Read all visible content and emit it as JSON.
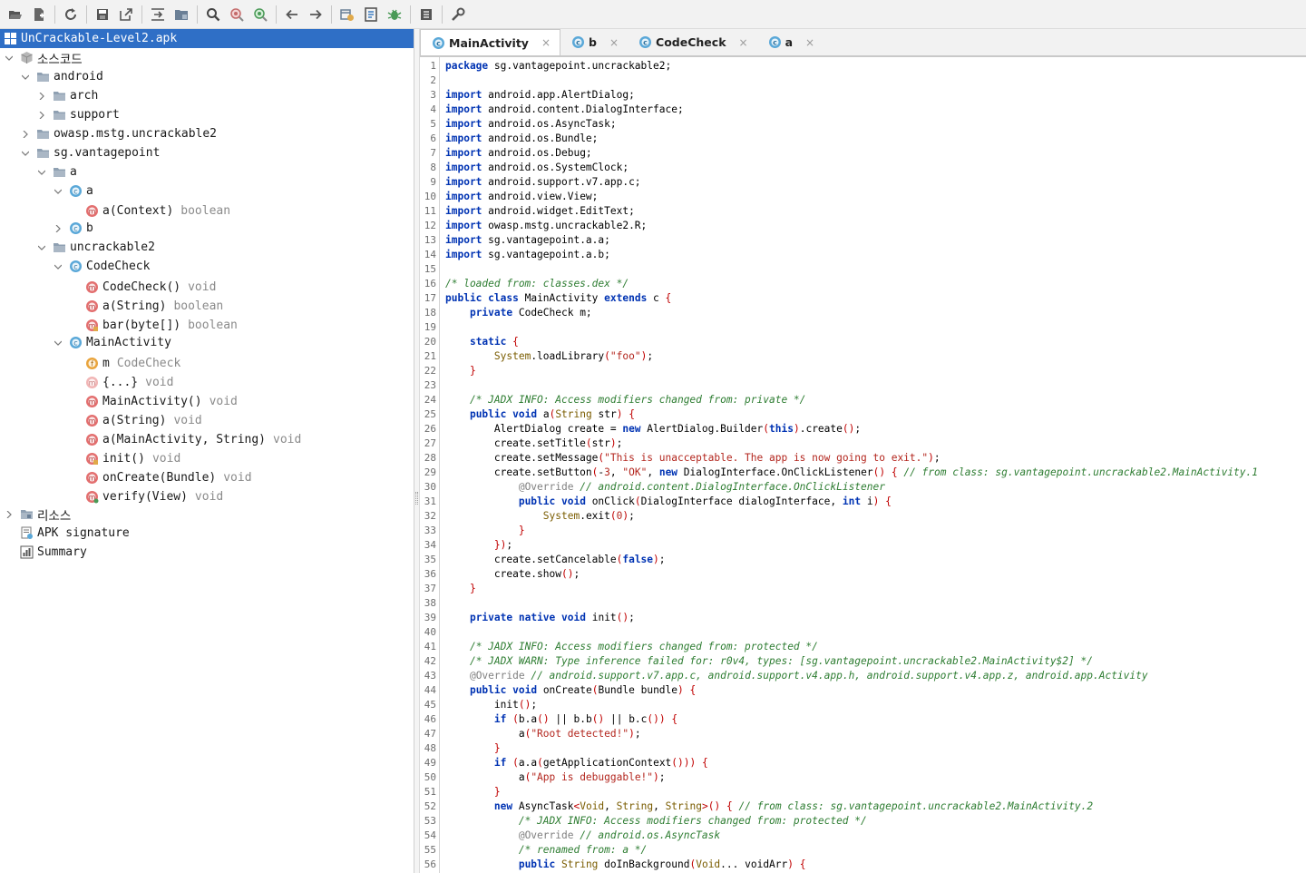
{
  "toolbar": {
    "icons": [
      "open-file-icon",
      "add-file-icon",
      "refresh-icon",
      "save-icon",
      "export-icon",
      "sync-tree-icon",
      "flatten-packages-icon",
      "search-icon",
      "search-class-icon",
      "search-usage-icon",
      "back-icon",
      "forward-icon",
      "deobfuscation-icon",
      "log-viewer-icon",
      "debug-icon",
      "text-icon",
      "preferences-icon"
    ]
  },
  "tree": {
    "root": "UnCrackable-Level2.apk",
    "sources": "소스코드",
    "pkg_android": "android",
    "pkg_arch": "arch",
    "pkg_support": "support",
    "pkg_owasp": "owasp.mstg.uncrackable2",
    "pkg_sg": "sg.vantagepoint",
    "pkg_a": "a",
    "cls_a": "a",
    "m_a_context": "a(Context)",
    "m_a_context_type": "boolean",
    "cls_b": "b",
    "pkg_uncrackable2": "uncrackable2",
    "cls_codecheck": "CodeCheck",
    "m_codecheck_ctor": "CodeCheck()",
    "m_codecheck_ctor_type": "void",
    "m_a_string": "a(String)",
    "m_a_string_type": "boolean",
    "m_bar": "bar(byte[])",
    "m_bar_type": "boolean",
    "cls_mainactivity": "MainActivity",
    "f_m": "m",
    "f_m_type": "CodeCheck",
    "m_static": "{...}",
    "m_static_type": "void",
    "m_main_ctor": "MainActivity()",
    "m_main_ctor_type": "void",
    "m_main_a_string": "a(String)",
    "m_main_a_string_type": "void",
    "m_main_a_two": "a(MainActivity, String)",
    "m_main_a_two_type": "void",
    "m_init": "init()",
    "m_init_type": "void",
    "m_oncreate": "onCreate(Bundle)",
    "m_oncreate_type": "void",
    "m_verify": "verify(View)",
    "m_verify_type": "void",
    "resources": "리소스",
    "apk_signature": "APK signature",
    "summary": "Summary"
  },
  "tabs": [
    {
      "label": "MainActivity",
      "close": "×"
    },
    {
      "label": "b",
      "close": "×"
    },
    {
      "label": "CodeCheck",
      "close": "×"
    },
    {
      "label": "a",
      "close": "×"
    }
  ],
  "code": [
    "package sg.vantagepoint.uncrackable2;",
    "",
    "import android.app.AlertDialog;",
    "import android.content.DialogInterface;",
    "import android.os.AsyncTask;",
    "import android.os.Bundle;",
    "import android.os.Debug;",
    "import android.os.SystemClock;",
    "import android.support.v7.app.c;",
    "import android.view.View;",
    "import android.widget.EditText;",
    "import owasp.mstg.uncrackable2.R;",
    "import sg.vantagepoint.a.a;",
    "import sg.vantagepoint.a.b;",
    "",
    "/* loaded from: classes.dex */",
    "public class MainActivity extends c {",
    "    private CodeCheck m;",
    "",
    "    static {",
    "        System.loadLibrary(\"foo\");",
    "    }",
    "",
    "    /* JADX INFO: Access modifiers changed from: private */",
    "    public void a(String str) {",
    "        AlertDialog create = new AlertDialog.Builder(this).create();",
    "        create.setTitle(str);",
    "        create.setMessage(\"This is unacceptable. The app is now going to exit.\");",
    "        create.setButton(-3, \"OK\", new DialogInterface.OnClickListener() { // from class: sg.vantagepoint.uncrackable2.MainActivity.1",
    "            @Override // android.content.DialogInterface.OnClickListener",
    "            public void onClick(DialogInterface dialogInterface, int i) {",
    "                System.exit(0);",
    "            }",
    "        });",
    "        create.setCancelable(false);",
    "        create.show();",
    "    }",
    "",
    "    private native void init();",
    "",
    "    /* JADX INFO: Access modifiers changed from: protected */",
    "    /* JADX WARN: Type inference failed for: r0v4, types: [sg.vantagepoint.uncrackable2.MainActivity$2] */",
    "    @Override // android.support.v7.app.c, android.support.v4.app.h, android.support.v4.app.z, android.app.Activity",
    "    public void onCreate(Bundle bundle) {",
    "        init();",
    "        if (b.a() || b.b() || b.c()) {",
    "            a(\"Root detected!\");",
    "        }",
    "        if (a.a(getApplicationContext())) {",
    "            a(\"App is debuggable!\");",
    "        }",
    "        new AsyncTask<Void, String, String>() { // from class: sg.vantagepoint.uncrackable2.MainActivity.2",
    "            /* JADX INFO: Access modifiers changed from: protected */",
    "            @Override // android.os.AsyncTask",
    "            /* renamed from: a */",
    "            public String doInBackground(Void... voidArr) {"
  ]
}
